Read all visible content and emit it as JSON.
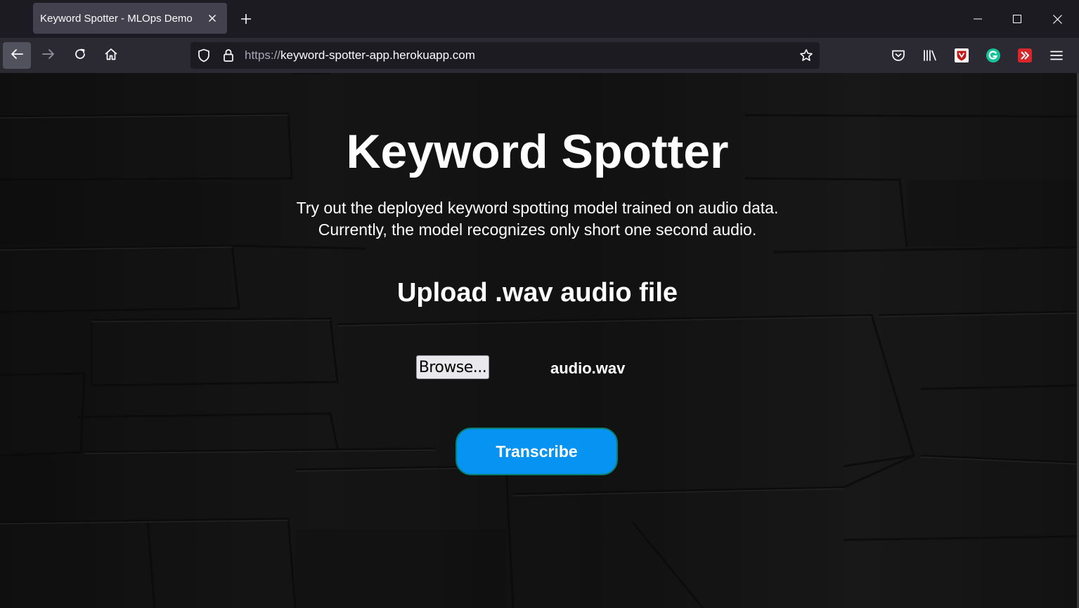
{
  "browser": {
    "tab_title": "Keyword Spotter - MLOps Demo",
    "url_protocol": "https://",
    "url_host": "keyword-spotter-app.herokuapp.com",
    "icons": {
      "back": "arrow-left-icon",
      "forward": "arrow-right-icon",
      "reload": "reload-icon",
      "home": "home-icon",
      "tracking": "shield-icon",
      "lock": "lock-icon",
      "bookmark": "star-icon",
      "pocket": "pocket-icon",
      "library": "library-icon",
      "ext1": "mcafee-icon",
      "ext2": "grammarly-icon",
      "ext3": "extension-icon",
      "menu": "hamburger-menu-icon"
    },
    "colors": {
      "grammarly": "#15c39a",
      "mcafee": "#c01818",
      "ext_red": "#d9262b"
    }
  },
  "page": {
    "title": "Keyword Spotter",
    "description_line1": "Try out the deployed keyword spotting model trained on audio data.",
    "description_line2": "Currently, the model recognizes only short one second audio.",
    "upload_heading": "Upload .wav audio file",
    "browse_label": "Browse...",
    "selected_file": "audio.wav",
    "transcribe_label": "Transcribe",
    "colors": {
      "transcribe_bg": "#0693f2",
      "transcribe_border": "#0b7f6e"
    }
  }
}
